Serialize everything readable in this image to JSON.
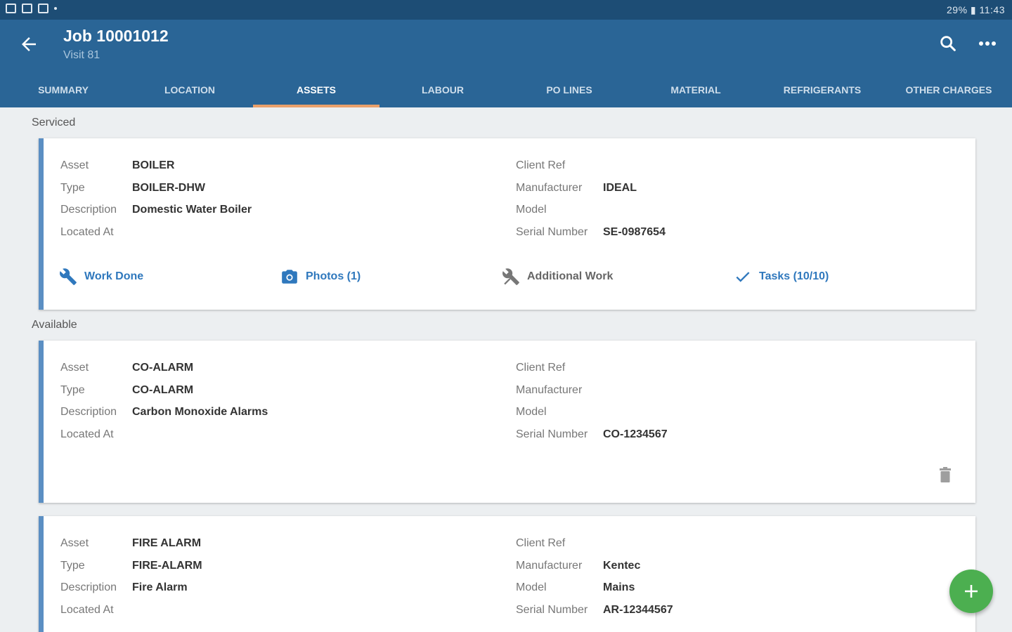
{
  "statusbar": {
    "right_text": "29% ▮ 11:43"
  },
  "header": {
    "title": "Job 10001012",
    "subtitle": "Visit 81"
  },
  "tabs": [
    {
      "label": "SUMMARY"
    },
    {
      "label": "LOCATION"
    },
    {
      "label": "ASSETS"
    },
    {
      "label": "LABOUR"
    },
    {
      "label": "PO LINES"
    },
    {
      "label": "MATERIAL"
    },
    {
      "label": "REFRIGERANTS"
    },
    {
      "label": "OTHER CHARGES"
    }
  ],
  "active_tab": "ASSETS",
  "sections": {
    "serviced": "Serviced",
    "available": "Available"
  },
  "field_labels": {
    "asset": "Asset",
    "type": "Type",
    "description": "Description",
    "located_at": "Located At",
    "client_ref": "Client Ref",
    "manufacturer": "Manufacturer",
    "model": "Model",
    "serial_number": "Serial Number"
  },
  "assets": [
    {
      "asset": "BOILER",
      "type": "BOILER-DHW",
      "description": "Domestic Water Boiler",
      "located_at": "",
      "client_ref": "",
      "manufacturer": "IDEAL",
      "model": "",
      "serial_number": "SE-0987654"
    },
    {
      "asset": "CO-ALARM",
      "type": "CO-ALARM",
      "description": "Carbon Monoxide Alarms",
      "located_at": "",
      "client_ref": "",
      "manufacturer": "",
      "model": "",
      "serial_number": "CO-1234567"
    },
    {
      "asset": "FIRE ALARM",
      "type": "FIRE-ALARM",
      "description": "Fire Alarm",
      "located_at": "",
      "client_ref": "",
      "manufacturer": "Kentec",
      "model": "Mains",
      "serial_number": "AR-12344567"
    }
  ],
  "actions": {
    "work_done": "Work Done",
    "photos": "Photos (1)",
    "additional_work": "Additional Work",
    "tasks": "Tasks (10/10)"
  },
  "colors": {
    "appbar": "#2a6596",
    "statusbar": "#1d4d75",
    "tab_indicator": "#e9a06b",
    "accent_blue": "#2f78bd",
    "card_border": "#5b8fc3",
    "fab": "#4caf50"
  }
}
